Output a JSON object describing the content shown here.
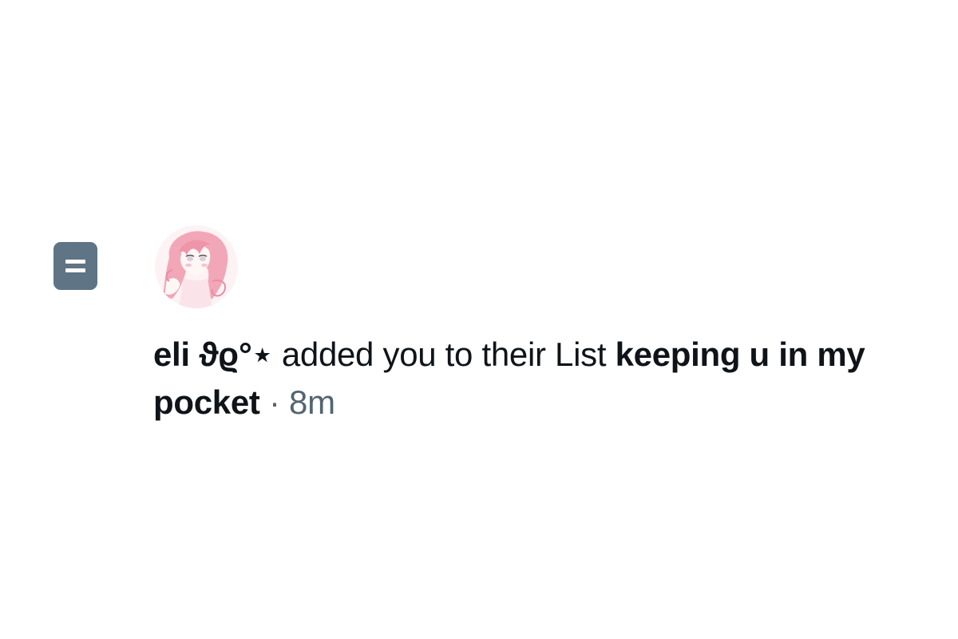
{
  "notification": {
    "type_icon": "list-icon",
    "avatar_icon": "pink-haired-anime-avatar",
    "display_name": "eli ϑϱ°⋆",
    "action_text": "added you to their List",
    "list_name": "keeping u in my pocket",
    "separator": "·",
    "timestamp": "8m"
  },
  "colors": {
    "list_icon_bg": "#5f7484",
    "primary_text": "#0f1419",
    "secondary_text": "#536471",
    "avatar_accent": "#f0a3b4"
  }
}
